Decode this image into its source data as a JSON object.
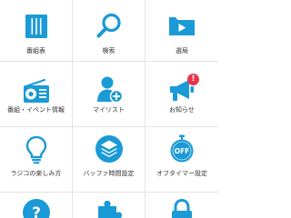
{
  "colors": {
    "accent": "#1a9ad6",
    "badge": "#e8334a",
    "divider": "#e3e3e3",
    "label": "#333333"
  },
  "menu": {
    "items": [
      {
        "label": "番組表",
        "icon": "program-guide-icon"
      },
      {
        "label": "検索",
        "icon": "search-icon"
      },
      {
        "label": "選局",
        "icon": "station-select-icon"
      },
      {
        "label": "番組・イベント情報",
        "icon": "radio-icon"
      },
      {
        "label": "マイリスト",
        "icon": "my-list-icon"
      },
      {
        "label": "お知らせ",
        "icon": "megaphone-icon",
        "badge": "!"
      },
      {
        "label": "ラジコの楽しみ方",
        "icon": "lightbulb-icon"
      },
      {
        "label": "バッファ時間設定",
        "icon": "buffer-layers-icon"
      },
      {
        "label": "オフタイマー設定",
        "icon": "off-timer-icon",
        "icon_text": "OFF"
      },
      {
        "label": "",
        "icon": "help-icon",
        "icon_text": "?"
      },
      {
        "label": "",
        "icon": "puzzle-icon"
      },
      {
        "label": "",
        "icon": "lock-icon"
      }
    ]
  }
}
